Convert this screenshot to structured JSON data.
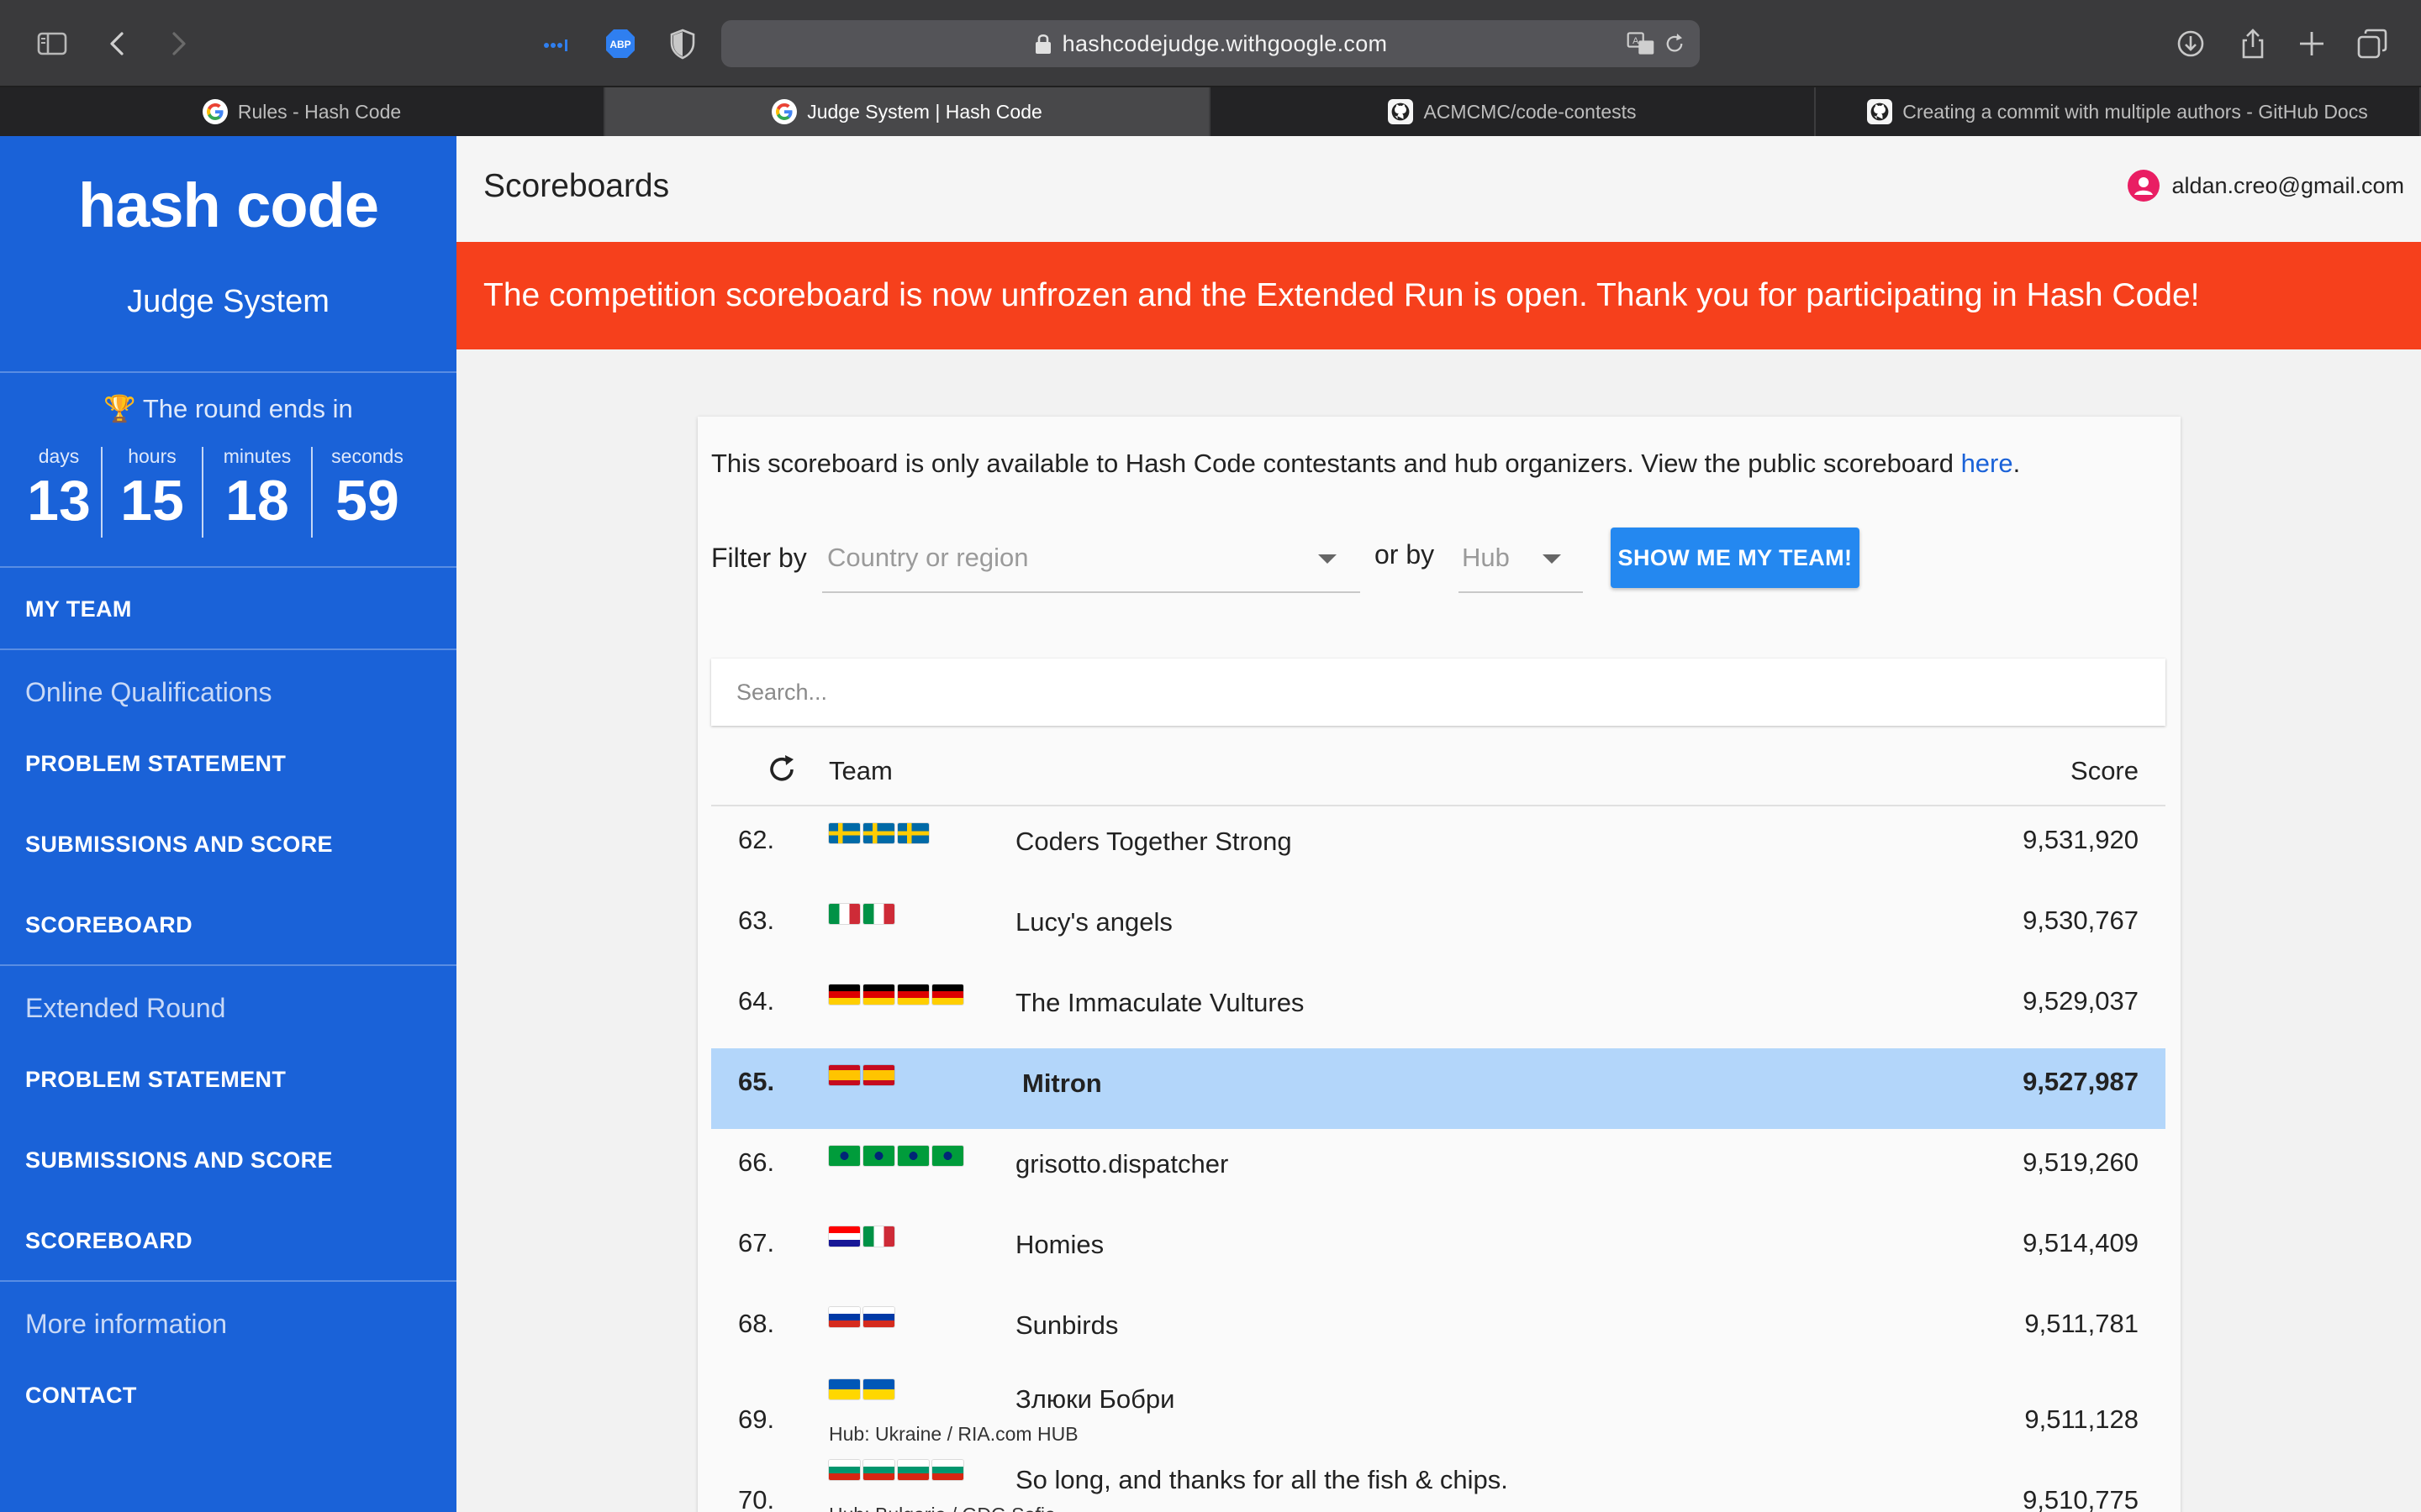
{
  "browser": {
    "url": "hashcodejudge.withgoogle.com",
    "tabs": [
      {
        "title": "Rules - Hash Code",
        "favicon": "google-icon",
        "active": false
      },
      {
        "title": "Judge System | Hash Code",
        "favicon": "google-icon",
        "active": true
      },
      {
        "title": "ACMCMC/code-contests",
        "favicon": "github-icon",
        "active": false
      },
      {
        "title": "Creating a commit with multiple authors - GitHub Docs",
        "favicon": "github-icon",
        "active": false
      }
    ],
    "extension_badge": "ABP"
  },
  "sidebar": {
    "logo": "hash code",
    "subtitle": "Judge System",
    "round_ends": "The round ends in",
    "countdown": [
      {
        "label": "days",
        "value": "13"
      },
      {
        "label": "hours",
        "value": "15"
      },
      {
        "label": "minutes",
        "value": "18"
      },
      {
        "label": "seconds",
        "value": "59"
      }
    ],
    "my_team": "MY TEAM",
    "sections": [
      {
        "title": "Online Qualifications",
        "links": [
          "PROBLEM STATEMENT",
          "SUBMISSIONS AND SCORE",
          "SCOREBOARD"
        ]
      },
      {
        "title": "Extended Round",
        "links": [
          "PROBLEM STATEMENT",
          "SUBMISSIONS AND SCORE",
          "SCOREBOARD"
        ]
      },
      {
        "title": "More information",
        "links": [
          "CONTACT"
        ]
      }
    ],
    "color": "#1a62d8"
  },
  "header": {
    "title": "Scoreboards",
    "user_email": "aldan.creo@gmail.com"
  },
  "banner": {
    "text": "The competition scoreboard is now unfrozen and the Extended Run is open. Thank you for participating in Hash Code!",
    "color": "#f6401c"
  },
  "scoreboard": {
    "notice_text": "This scoreboard is only available to Hash Code contestants and hub organizers. View the public scoreboard ",
    "notice_link": "here",
    "notice_end": ".",
    "filter_label": "Filter by",
    "country_placeholder": "Country or region",
    "or_by": "or by",
    "hub_placeholder": "Hub",
    "my_team_button": "SHOW ME MY TEAM!",
    "search_placeholder": "Search...",
    "col_team": "Team",
    "col_score": "Score",
    "rows": [
      {
        "rank": "62.",
        "flags": [
          "se",
          "se",
          "se"
        ],
        "team": "Coders Together Strong",
        "score": "9,531,920",
        "hub": "",
        "highlight": false
      },
      {
        "rank": "63.",
        "flags": [
          "it",
          "it"
        ],
        "team": "Lucy's angels",
        "score": "9,530,767",
        "hub": "",
        "highlight": false
      },
      {
        "rank": "64.",
        "flags": [
          "de",
          "de",
          "de",
          "de"
        ],
        "team": "The Immaculate Vultures",
        "score": "9,529,037",
        "hub": "",
        "highlight": false
      },
      {
        "rank": "65.",
        "flags": [
          "es",
          "es"
        ],
        "team": "Mitron",
        "score": "9,527,987",
        "hub": "",
        "highlight": true
      },
      {
        "rank": "66.",
        "flags": [
          "br",
          "br",
          "br",
          "br"
        ],
        "team": "grisotto.dispatcher",
        "score": "9,519,260",
        "hub": "",
        "highlight": false
      },
      {
        "rank": "67.",
        "flags": [
          "hr",
          "it"
        ],
        "team": "Homies",
        "score": "9,514,409",
        "hub": "",
        "highlight": false
      },
      {
        "rank": "68.",
        "flags": [
          "ru",
          "ru"
        ],
        "team": "Sunbirds",
        "score": "9,511,781",
        "hub": "",
        "highlight": false
      },
      {
        "rank": "69.",
        "flags": [
          "ua",
          "ua"
        ],
        "team": "Злюки Бобри",
        "score": "9,511,128",
        "hub": "Hub: Ukraine / RIA.com HUB",
        "highlight": false
      },
      {
        "rank": "70.",
        "flags": [
          "bg",
          "bg",
          "bg",
          "bg"
        ],
        "team": "So long, and thanks for all the fish & chips.",
        "score": "9,510,775",
        "hub": "Hub: Bulgaria / GDG Sofia",
        "highlight": false
      }
    ]
  }
}
